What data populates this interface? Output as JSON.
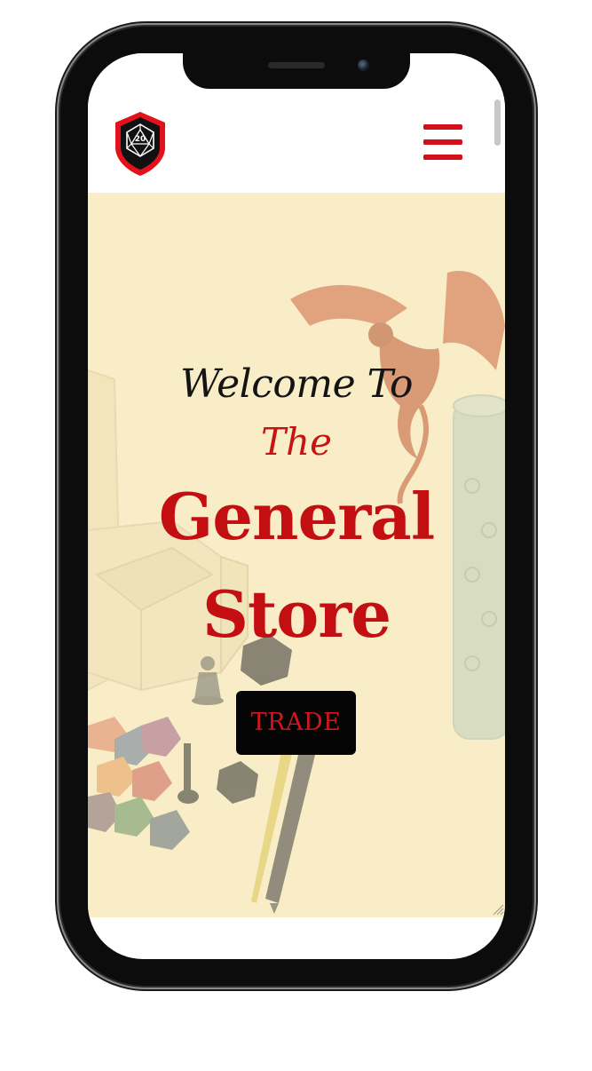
{
  "hero": {
    "welcome": "Welcome To",
    "the": "The",
    "general": "General",
    "store": "Store",
    "trade_label": "TRADE"
  },
  "header": {
    "logo_badge": "20",
    "logo_icon": "d20-shield-icon",
    "menu_icon": "hamburger-menu-icon"
  },
  "colors": {
    "accent_red": "#d0111c",
    "hero_background": "#f8ebc2",
    "button_background": "#050505",
    "heading_dark": "#141414"
  }
}
